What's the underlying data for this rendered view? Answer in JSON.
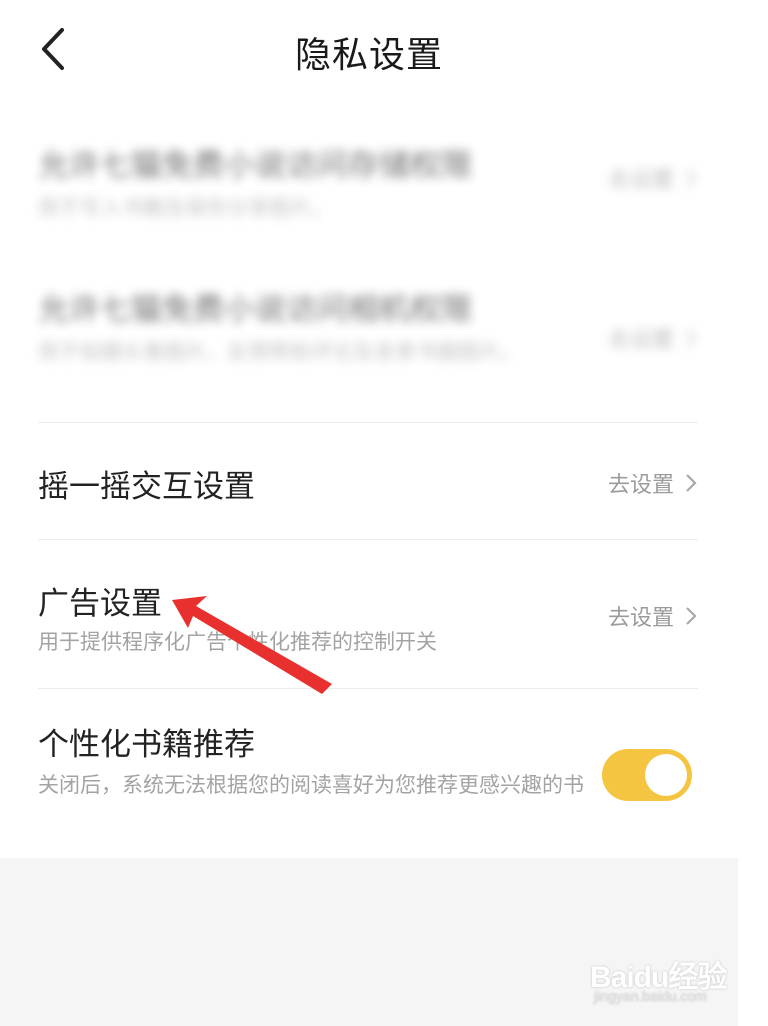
{
  "header": {
    "title": "隐私设置"
  },
  "settings": {
    "blurred_1": {
      "title": "允许七猫免费小说访问存储权限",
      "desc": "用于写入书籍及保存分享图片。",
      "action": "去设置"
    },
    "blurred_2": {
      "title": "允许七猫免费小说访问相机权限",
      "desc": "用于拍摄头像图片、反馈帮助评论及发表书圈图片。",
      "action": "去设置"
    },
    "shake": {
      "title": "摇一摇交互设置",
      "action": "去设置"
    },
    "ads": {
      "title": "广告设置",
      "desc": "用于提供程序化广告个性化推荐的控制开关",
      "action": "去设置"
    },
    "personalized": {
      "title": "个性化书籍推荐",
      "desc": "关闭后，系统无法根据您的阅读喜好为您推荐更感兴趣的书",
      "enabled": true
    }
  },
  "colors": {
    "toggle_on": "#f5c542",
    "arrow": "#e8312f",
    "secondary_text": "#9b9b9b"
  },
  "watermark": {
    "brand": "Baidu经验",
    "url": "jingyan.baidu.com"
  }
}
